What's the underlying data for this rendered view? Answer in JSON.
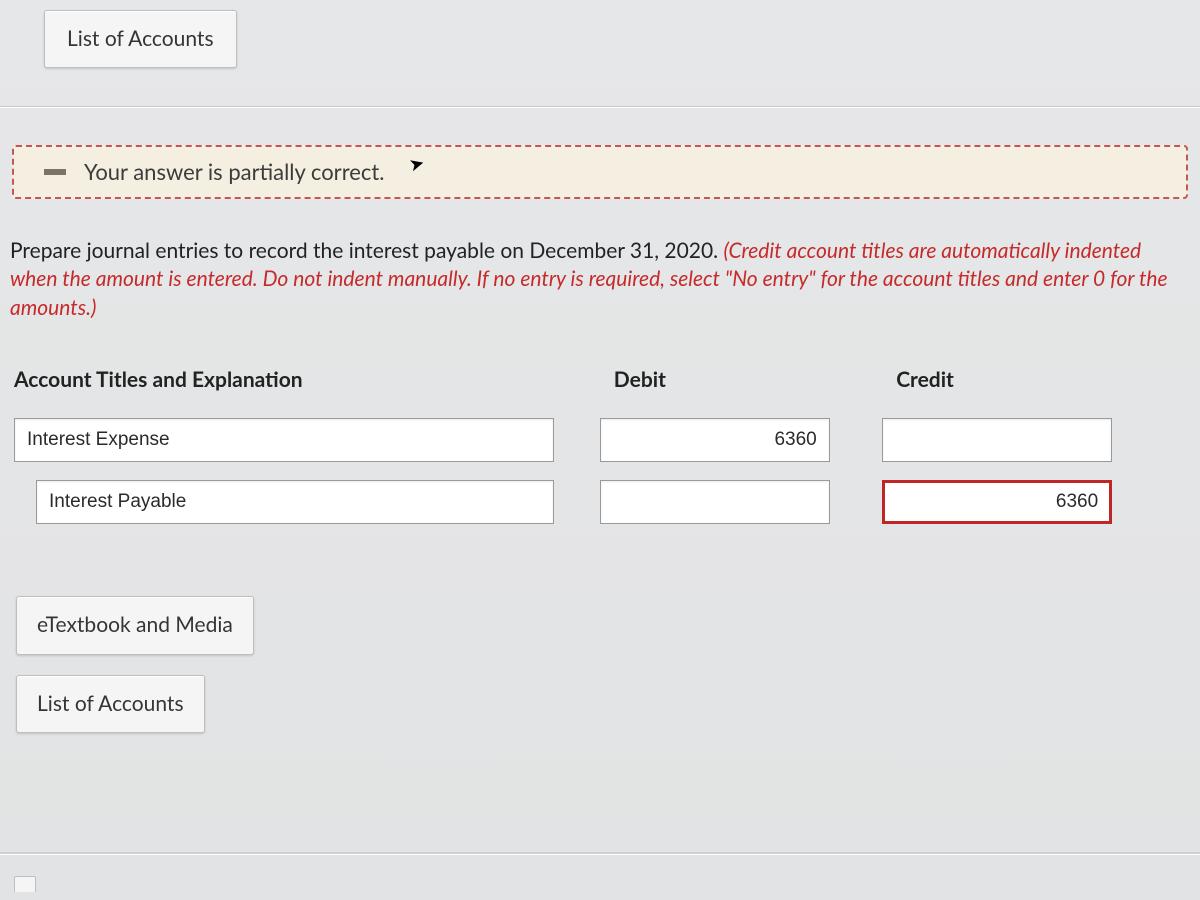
{
  "topTabs": {
    "listOfAccounts": "List of Accounts"
  },
  "feedback": {
    "text": "Your answer is partially correct.",
    "icon": "minus-icon"
  },
  "prompt": {
    "main": "Prepare journal entries to record the interest payable on December 31, 2020. ",
    "hint": "(Credit account titles are automatically indented when the amount is entered. Do not indent manually. If no entry is required, select \"No entry\" for the account titles and enter 0 for the amounts.)"
  },
  "table": {
    "headers": {
      "account": "Account Titles and Explanation",
      "debit": "Debit",
      "credit": "Credit"
    },
    "rows": [
      {
        "account": "Interest Expense",
        "account_indent": false,
        "debit": "6360",
        "debit_wrong": false,
        "credit": "",
        "credit_wrong": false
      },
      {
        "account": "Interest Payable",
        "account_indent": true,
        "debit": "",
        "debit_wrong": false,
        "credit": "6360",
        "credit_wrong": true
      }
    ]
  },
  "bottomButtons": {
    "etextbook": "eTextbook and Media",
    "listOfAccounts": "List of Accounts"
  }
}
